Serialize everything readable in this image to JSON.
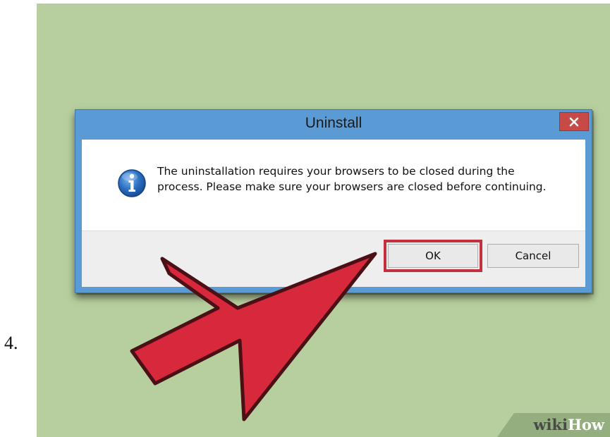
{
  "step": {
    "number": "4."
  },
  "dialog": {
    "title": "Uninstall",
    "close_icon": "close-icon",
    "info_icon": "information-icon",
    "message_line1": "The uninstallation requires your browsers to be closed during the",
    "message_line2": "process. Please make sure your browsers are closed before continuing.",
    "ok_label": "OK",
    "cancel_label": "Cancel"
  },
  "annotation": {
    "arrow_color": "#d8293c",
    "highlight_color": "#c4303e",
    "arrow_icon": "pointer-arrow-icon"
  },
  "watermark": {
    "wiki": "wiki",
    "how": "How"
  },
  "colors": {
    "background": "#b7cf9e",
    "titlebar": "#5b9bd5",
    "close_button": "#c84a46",
    "info_icon": "#2b6fc1"
  }
}
